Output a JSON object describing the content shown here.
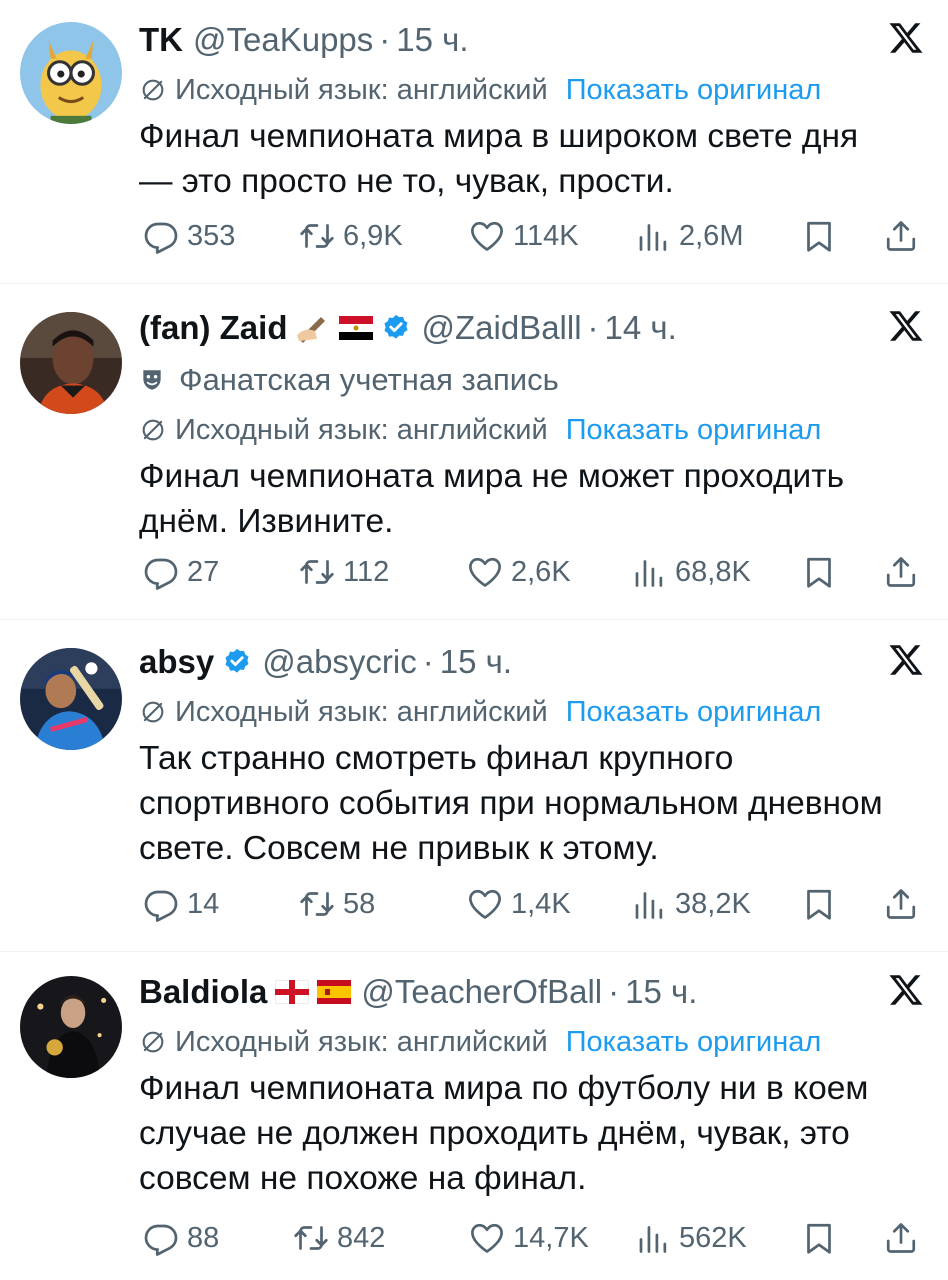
{
  "accent_color": "#1d9bf0",
  "secondary_text_color": "#536471",
  "tweets": [
    {
      "name": "TK",
      "handle": "@TeaKupps",
      "dot": "·",
      "time": "15 ч.",
      "fan_account": "",
      "translation_note": "Исходный язык: английский",
      "show_original": "Показать оригинал",
      "lines": [
        "Финал чемпионата мира в широком свете дня",
        "— это просто не то, чувак, прости."
      ],
      "stats": {
        "replies": "353",
        "retweets": "6,9K",
        "likes": "114K",
        "views": "2,6M"
      }
    },
    {
      "name": "(fan) Zaid",
      "handle": "@ZaidBalll",
      "dot": "·",
      "time": "14 ч.",
      "fan_account": "Фанатская учетная запись",
      "translation_note": "Исходный язык: английский",
      "show_original": "Показать оригинал",
      "lines": [
        "Финал чемпионата мира не может проходить",
        "днём. Извините."
      ],
      "stats": {
        "replies": "27",
        "retweets": "112",
        "likes": "2,6K",
        "views": "68,8K"
      }
    },
    {
      "name": "absy",
      "handle": "@absycric",
      "dot": "·",
      "time": "15 ч.",
      "fan_account": "",
      "translation_note": "Исходный язык: английский",
      "show_original": "Показать оригинал",
      "lines": [
        "Так странно смотреть финал крупного",
        "спортивного события при нормальном дневном",
        "свете. Совсем не привык к этому."
      ],
      "stats": {
        "replies": "14",
        "retweets": "58",
        "likes": "1,4K",
        "views": "38,2K"
      }
    },
    {
      "name": "Baldiola",
      "handle": "@TeacherOfBall",
      "dot": "·",
      "time": "15 ч.",
      "fan_account": "",
      "translation_note": "Исходный язык: английский",
      "show_original": "Показать оригинал",
      "lines": [
        "Финал чемпионата мира по футболу ни в коем",
        "случае не должен проходить днём, чувак, это",
        "совсем не похоже на финал."
      ],
      "stats": {
        "replies": "88",
        "retweets": "842",
        "likes": "14,7K",
        "views": "562K"
      }
    }
  ],
  "icons": {
    "reply": "reply-icon",
    "retweet": "retweet-icon",
    "like": "like-icon",
    "views": "views-icon",
    "bookmark": "bookmark-icon",
    "share": "share-icon",
    "x_logo": "x-logo-icon",
    "translate": "globe-icon",
    "verified": "verified-badge-icon",
    "fan_mask": "theater-mask-icon"
  }
}
